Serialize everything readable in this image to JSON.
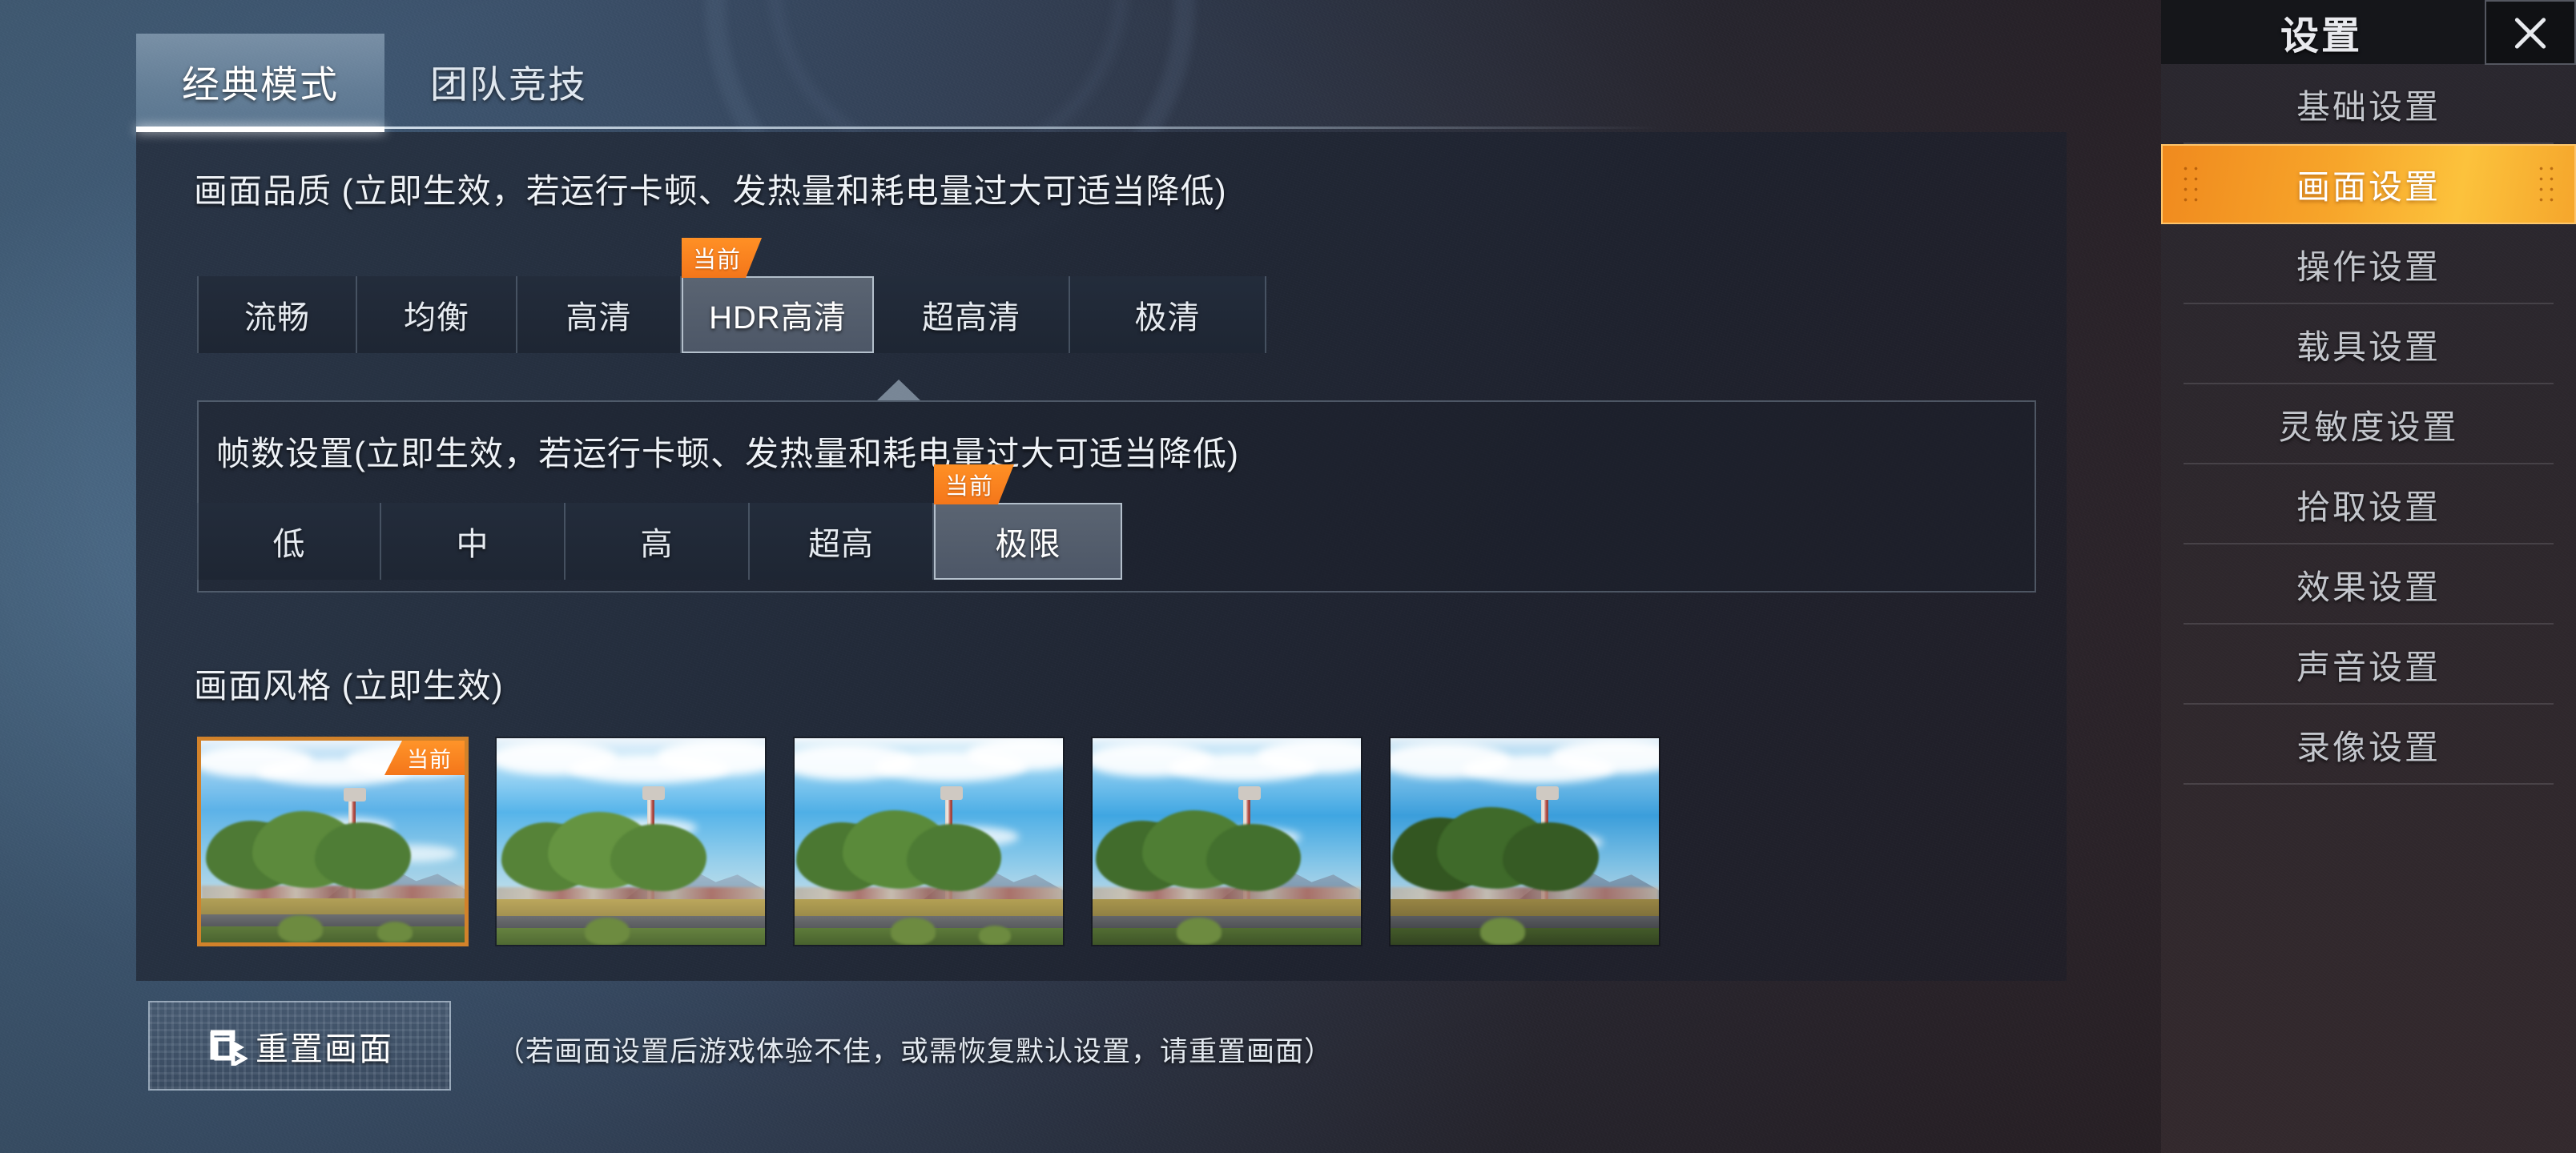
{
  "tabs": [
    {
      "label": "经典模式",
      "active": true
    },
    {
      "label": "团队竞技",
      "active": false
    }
  ],
  "graphics_quality": {
    "title": "画面品质 (立即生效，若运行卡顿、发热量和耗电量过大可适当降低)",
    "current_badge": "当前",
    "options": [
      {
        "label": "流畅",
        "selected": false
      },
      {
        "label": "均衡",
        "selected": false
      },
      {
        "label": "高清",
        "selected": false
      },
      {
        "label": "HDR高清",
        "selected": true
      },
      {
        "label": "超高清",
        "selected": false
      },
      {
        "label": "极清",
        "selected": false
      }
    ]
  },
  "frame_rate": {
    "title": "帧数设置(立即生效，若运行卡顿、发热量和耗电量过大可适当降低)",
    "current_badge": "当前",
    "options": [
      {
        "label": "低",
        "selected": false
      },
      {
        "label": "中",
        "selected": false
      },
      {
        "label": "高",
        "selected": false
      },
      {
        "label": "超高",
        "selected": false
      },
      {
        "label": "极限",
        "selected": true
      }
    ]
  },
  "picture_style": {
    "title": "画面风格 (立即生效)",
    "current_badge": "当前",
    "thumbnails": [
      {
        "name": "style-1",
        "selected": true,
        "tone": "classic"
      },
      {
        "name": "style-2",
        "selected": false,
        "tone": "soft"
      },
      {
        "name": "style-3",
        "selected": false,
        "tone": "bright"
      },
      {
        "name": "style-4",
        "selected": false,
        "tone": "vivid"
      },
      {
        "name": "style-5",
        "selected": false,
        "tone": "deep"
      }
    ]
  },
  "reset": {
    "button_label": "重置画面",
    "hint": "（若画面设置后游戏体验不佳，或需恢复默认设置，请重置画面）"
  },
  "sidebar": {
    "title": "设置",
    "close_label": "×",
    "items": [
      {
        "label": "基础设置",
        "active": false
      },
      {
        "label": "画面设置",
        "active": true
      },
      {
        "label": "操作设置",
        "active": false
      },
      {
        "label": "载具设置",
        "active": false
      },
      {
        "label": "灵敏度设置",
        "active": false
      },
      {
        "label": "拾取设置",
        "active": false
      },
      {
        "label": "效果设置",
        "active": false
      },
      {
        "label": "声音设置",
        "active": false
      },
      {
        "label": "录像设置",
        "active": false
      }
    ]
  },
  "colors": {
    "accent_orange": "#f4761a",
    "accent_orange_light": "#fcc23c",
    "selected_border": "#c4d0dc",
    "panel_bg": "#222a39",
    "sidebar_bg": "#2e282d"
  }
}
